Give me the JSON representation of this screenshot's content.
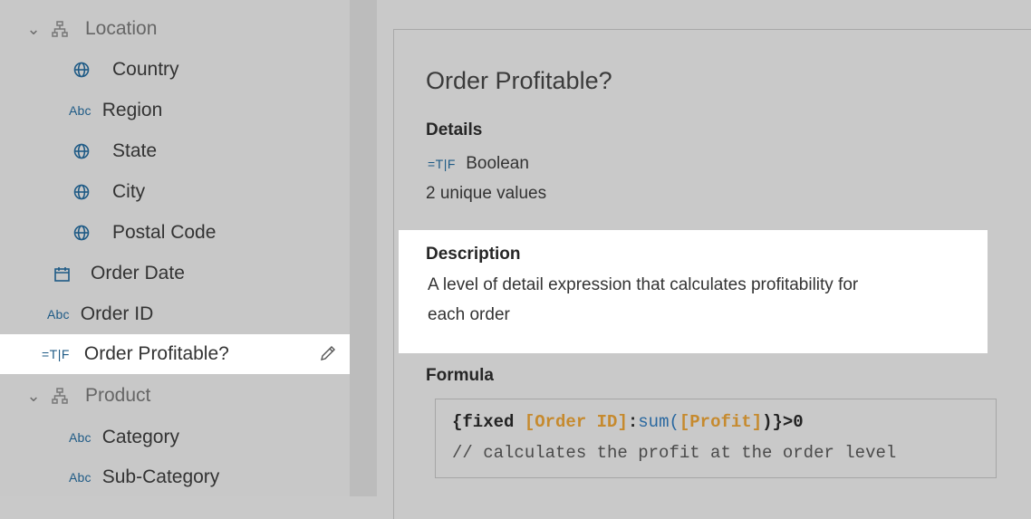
{
  "sidebar": {
    "items": [
      {
        "label": "Location",
        "icon": "hierarchy-icon",
        "kind": "folder"
      },
      {
        "label": "Country",
        "icon": "globe-icon"
      },
      {
        "label": "Region",
        "icon": "abc-string-icon",
        "icon_text": "Abc"
      },
      {
        "label": "State",
        "icon": "globe-icon"
      },
      {
        "label": "City",
        "icon": "globe-icon"
      },
      {
        "label": "Postal Code",
        "icon": "globe-icon"
      },
      {
        "label": "Order Date",
        "icon": "calendar-icon"
      },
      {
        "label": "Order ID",
        "icon": "abc-string-icon",
        "icon_text": "Abc"
      },
      {
        "label": "Order Profitable?",
        "icon": "boolean-icon",
        "icon_text": "=T|F",
        "selected": true
      },
      {
        "label": "Product",
        "icon": "hierarchy-icon",
        "kind": "folder"
      },
      {
        "label": "Category",
        "icon": "abc-string-icon",
        "icon_text": "Abc"
      },
      {
        "label": "Sub-Category",
        "icon": "abc-string-icon",
        "icon_text": "Abc"
      }
    ]
  },
  "details": {
    "title": "Order Profitable?",
    "details_heading": "Details",
    "type_icon_text": "=T|F",
    "type_label": "Boolean",
    "unique_values": "2 unique values",
    "description_heading": "Description",
    "description_line1": "A level of detail expression that calculates profitability for",
    "description_line2": "each order",
    "formula_heading": "Formula",
    "formula": {
      "open": "{fixed ",
      "field1": "[Order ID]",
      "colon": ":",
      "func": "sum(",
      "field2": "[Profit]",
      "close": ")}>0",
      "comment": "// calculates the profit at the order level"
    }
  },
  "colors": {
    "accent_blue": "#1f5b86",
    "field_orange": "#c68a2e",
    "highlight": "#ffffff",
    "background": "#c9c9c9"
  }
}
